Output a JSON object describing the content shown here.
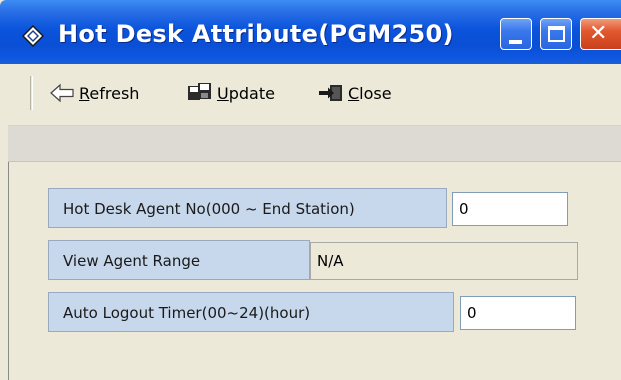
{
  "window": {
    "title": "Hot Desk Attribute(PGM250)",
    "title_bar_color": "#0a4fd6",
    "icons": {
      "app": "diamond-icon",
      "minimize": "minimize-icon",
      "maximize": "maximize-icon",
      "close": "close-icon"
    },
    "close_glyph": "✕"
  },
  "toolbar": {
    "refresh": {
      "label_key": "R",
      "label_rest": "efresh",
      "icon": "arrow-left-icon"
    },
    "update": {
      "label_key": "U",
      "label_rest": "pdate",
      "icon": "save-icon"
    },
    "close": {
      "label_key": "C",
      "label_rest": "lose",
      "icon": "exit-icon"
    }
  },
  "form": {
    "fields": [
      {
        "label": "Hot Desk Agent No(000 ~ End Station)",
        "value": "0",
        "editable": true
      },
      {
        "label": "View Agent Range",
        "value": "N/A",
        "editable": false
      },
      {
        "label": "Auto Logout Timer(00~24)(hour)",
        "value": "0",
        "editable": true
      }
    ]
  },
  "colors": {
    "label_background": "#c7d7ec",
    "window_background": "#ece9d8",
    "close_button": "#c9401c"
  }
}
